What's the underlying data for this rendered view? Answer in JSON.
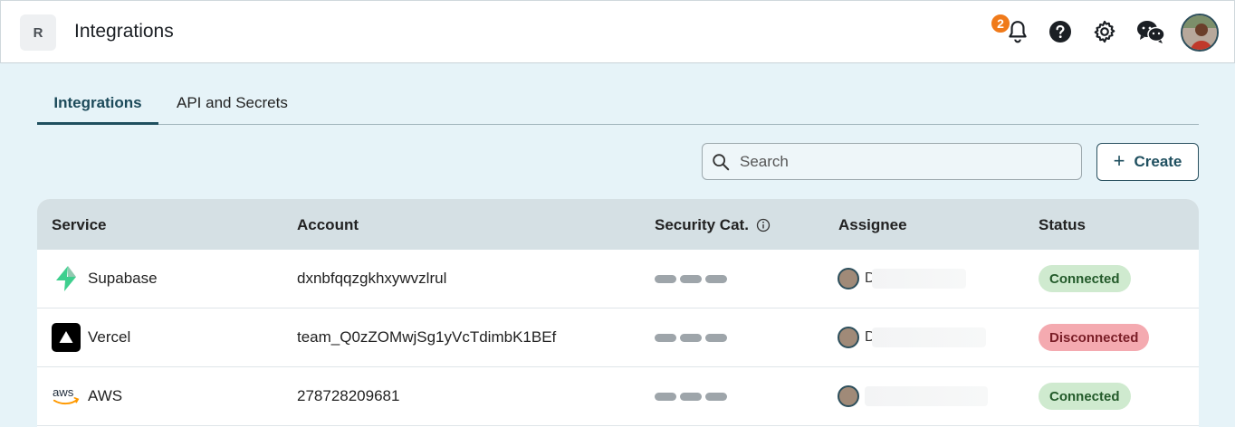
{
  "header": {
    "logo_letter": "R",
    "title": "Integrations",
    "notification_count": "2",
    "icons": [
      "bell-icon",
      "help-icon",
      "gear-icon",
      "chat-icon"
    ]
  },
  "tabs": [
    {
      "label": "Integrations",
      "active": true
    },
    {
      "label": "API and Secrets",
      "active": false
    }
  ],
  "toolbar": {
    "search_placeholder": "Search",
    "create_label": "Create"
  },
  "table": {
    "columns": [
      "Service",
      "Account",
      "Security Cat.",
      "Assignee",
      "Status"
    ],
    "rows": [
      {
        "service": "Supabase",
        "service_icon": "supabase-icon",
        "account": "dxnbfqqzgkhxywvzlrul",
        "assignee_initial": "D",
        "status": "Connected"
      },
      {
        "service": "Vercel",
        "service_icon": "vercel-icon",
        "account": "team_Q0zZOMwjSg1yVcTdimbK1BEf",
        "assignee_initial": "D",
        "status": "Disconnected"
      },
      {
        "service": "AWS",
        "service_icon": "aws-icon",
        "account": "278728209681",
        "assignee_initial": "",
        "status": "Connected"
      }
    ]
  },
  "colors": {
    "accent": "#1f4f5f",
    "notification": "#f07a1a",
    "connected_bg": "#cfeacf",
    "disconnected_bg": "#f4aab0",
    "page_bg": "#e6f3f8"
  }
}
